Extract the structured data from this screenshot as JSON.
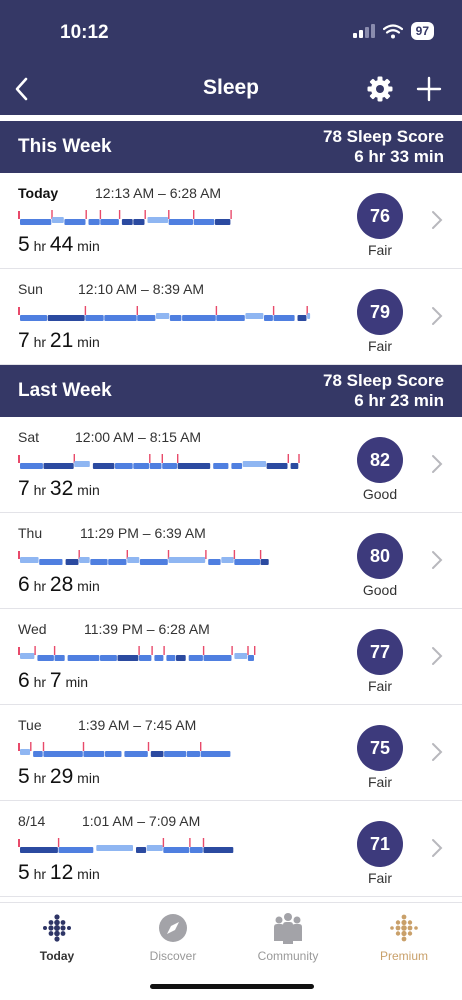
{
  "status_bar": {
    "time": "10:12",
    "battery": "97"
  },
  "nav": {
    "title": "Sleep"
  },
  "sections": [
    {
      "title": "This Week",
      "score_line": "78 Sleep Score",
      "duration_line": "6 hr 33 min"
    },
    {
      "title": "Last Week",
      "score_line": "78 Sleep Score",
      "duration_line": "6 hr 23 min"
    }
  ],
  "entries": [
    {
      "day": "Today",
      "range": "12:13 AM – 6:28 AM",
      "hours": "5",
      "minutes": "44",
      "score": "76",
      "rating": "Fair",
      "bar_fraction": 0.72
    },
    {
      "day": "Sun",
      "range": "12:10 AM – 8:39 AM",
      "hours": "7",
      "minutes": "21",
      "score": "79",
      "rating": "Fair",
      "bar_fraction": 0.99
    },
    {
      "day": "Sat",
      "range": "12:00 AM – 8:15 AM",
      "hours": "7",
      "minutes": "32",
      "score": "82",
      "rating": "Good",
      "bar_fraction": 0.95
    },
    {
      "day": "Thu",
      "range": "11:29 PM – 6:39 AM",
      "hours": "6",
      "minutes": "28",
      "score": "80",
      "rating": "Good",
      "bar_fraction": 0.85
    },
    {
      "day": "Wed",
      "range": "11:39 PM – 6:28 AM",
      "hours": "6",
      "minutes": "7",
      "score": "77",
      "rating": "Fair",
      "bar_fraction": 0.8
    },
    {
      "day": "Tue",
      "range": "1:39 AM – 7:45 AM",
      "hours": "5",
      "minutes": "29",
      "score": "75",
      "rating": "Fair",
      "bar_fraction": 0.72
    },
    {
      "day": "8/14",
      "range": "1:01 AM – 7:09 AM",
      "hours": "5",
      "minutes": "12",
      "score": "71",
      "rating": "Fair",
      "bar_fraction": 0.73
    }
  ],
  "units": {
    "hr": "hr",
    "min": "min"
  },
  "tabs": [
    {
      "label": "Today",
      "icon": "fitbit-dots-icon"
    },
    {
      "label": "Discover",
      "icon": "compass-icon"
    },
    {
      "label": "Community",
      "icon": "community-icon"
    },
    {
      "label": "Premium",
      "icon": "premium-dots-icon"
    }
  ],
  "colors": {
    "header_bg": "#353866",
    "score_circle": "#3d3a7c",
    "deep": "#2b4aa0",
    "light": "#4f7fe0",
    "rem": "#8fb6f2",
    "awake": "#e84a6a",
    "premium": "#c9a06a"
  }
}
